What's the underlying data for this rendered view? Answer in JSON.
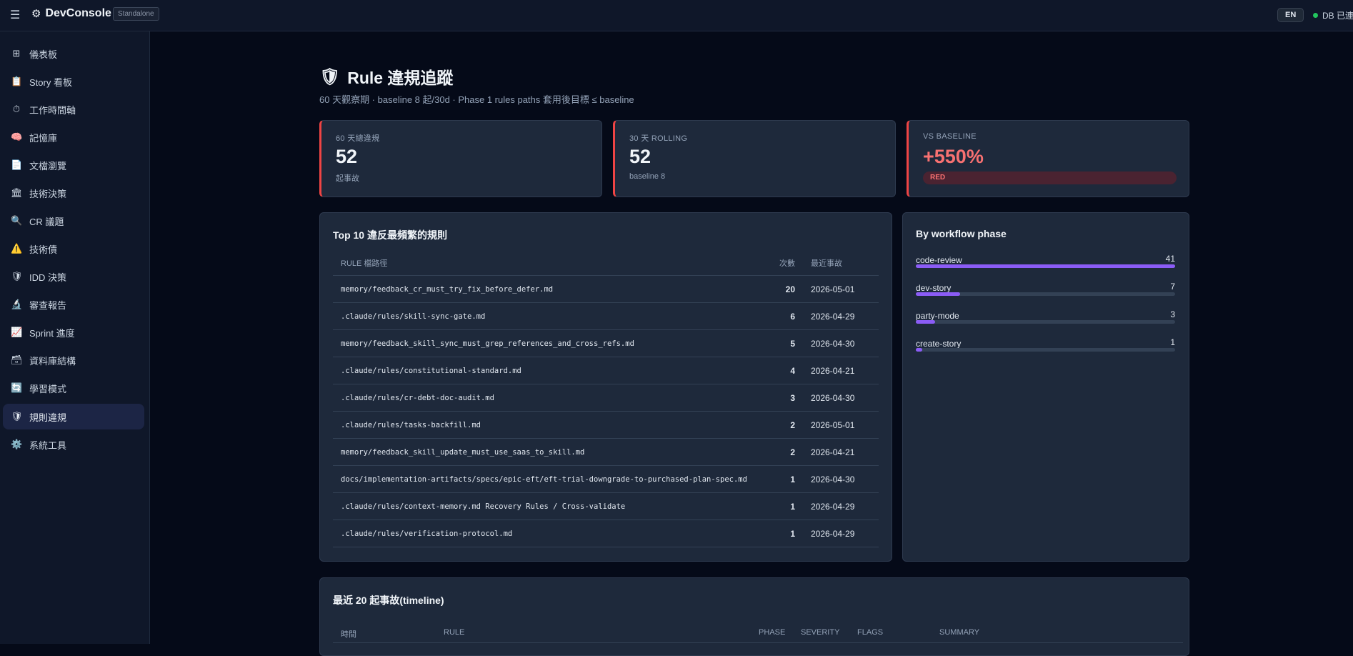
{
  "topbar": {
    "brand": "DevConsole",
    "badge": "Standalone",
    "lang": "EN",
    "db_status": "DB 已連線"
  },
  "sidebar": {
    "items": [
      {
        "label": "儀表板",
        "icon": "grid-icon"
      },
      {
        "label": "Story 看板",
        "icon": "clipboard-icon"
      },
      {
        "label": "工作時間軸",
        "icon": "stopwatch-icon"
      },
      {
        "label": "記憶庫",
        "icon": "brain-icon"
      },
      {
        "label": "文檔瀏覽",
        "icon": "document-icon"
      },
      {
        "label": "技術決策",
        "icon": "classical-building-icon"
      },
      {
        "label": "CR 議題",
        "icon": "magnifier-icon"
      },
      {
        "label": "技術債",
        "icon": "warning-icon"
      },
      {
        "label": "IDD 決策",
        "icon": "shield-icon"
      },
      {
        "label": "審查報告",
        "icon": "microscope-icon"
      },
      {
        "label": "Sprint 進度",
        "icon": "chart-icon"
      },
      {
        "label": "資料庫結構",
        "icon": "file-cabinet-icon"
      },
      {
        "label": "學習模式",
        "icon": "refresh-icon"
      },
      {
        "label": "規則違規",
        "icon": "shield-icon",
        "active": true
      },
      {
        "label": "系統工具",
        "icon": "gear-icon"
      }
    ]
  },
  "page": {
    "title": "Rule 違規追蹤",
    "subtitle": "60 天觀察期 · baseline 8 起/30d · Phase 1 rules paths 套用後目標 ≤ baseline"
  },
  "stats": [
    {
      "label": "60 天總違規",
      "value": "52",
      "sub": "起事故"
    },
    {
      "label": "30 天 ROLLING",
      "value": "52",
      "sub": "baseline 8"
    },
    {
      "label": "VS BASELINE",
      "value": "+550%",
      "badge": "RED"
    }
  ],
  "top_rules": {
    "title": "Top 10 違反最頻繁的規則",
    "headers": {
      "path": "RULE 檔路徑",
      "count": "次數",
      "last": "最近事故"
    },
    "rows": [
      {
        "path": "memory/feedback_cr_must_try_fix_before_defer.md",
        "count": "20",
        "last": "2026-05-01"
      },
      {
        "path": ".claude/rules/skill-sync-gate.md",
        "count": "6",
        "last": "2026-04-29"
      },
      {
        "path": "memory/feedback_skill_sync_must_grep_references_and_cross_refs.md",
        "count": "5",
        "last": "2026-04-30"
      },
      {
        "path": ".claude/rules/constitutional-standard.md",
        "count": "4",
        "last": "2026-04-21"
      },
      {
        "path": ".claude/rules/cr-debt-doc-audit.md",
        "count": "3",
        "last": "2026-04-30"
      },
      {
        "path": ".claude/rules/tasks-backfill.md",
        "count": "2",
        "last": "2026-05-01"
      },
      {
        "path": "memory/feedback_skill_update_must_use_saas_to_skill.md",
        "count": "2",
        "last": "2026-04-21"
      },
      {
        "path": "docs/implementation-artifacts/specs/epic-eft/eft-trial-downgrade-to-purchased-plan-spec.md",
        "count": "1",
        "last": "2026-04-30"
      },
      {
        "path": ".claude/rules/context-memory.md Recovery Rules / Cross-validate",
        "count": "1",
        "last": "2026-04-29"
      },
      {
        "path": ".claude/rules/verification-protocol.md",
        "count": "1",
        "last": "2026-04-29"
      }
    ]
  },
  "phases": {
    "title": "By workflow phase",
    "max": 41,
    "items": [
      {
        "name": "code-review",
        "value": 41
      },
      {
        "name": "dev-story",
        "value": 7
      },
      {
        "name": "party-mode",
        "value": 3
      },
      {
        "name": "create-story",
        "value": 1
      }
    ]
  },
  "timeline": {
    "title": "最近 20 起事故(timeline)",
    "headers": {
      "time": "時間",
      "rule": "RULE",
      "phase": "PHASE",
      "severity": "SEVERITY",
      "flags": "FLAGS",
      "summary": "SUMMARY"
    }
  },
  "colors": {
    "accent": "#8b5cf6",
    "danger": "#ef4444",
    "ok": "#22c55e"
  }
}
